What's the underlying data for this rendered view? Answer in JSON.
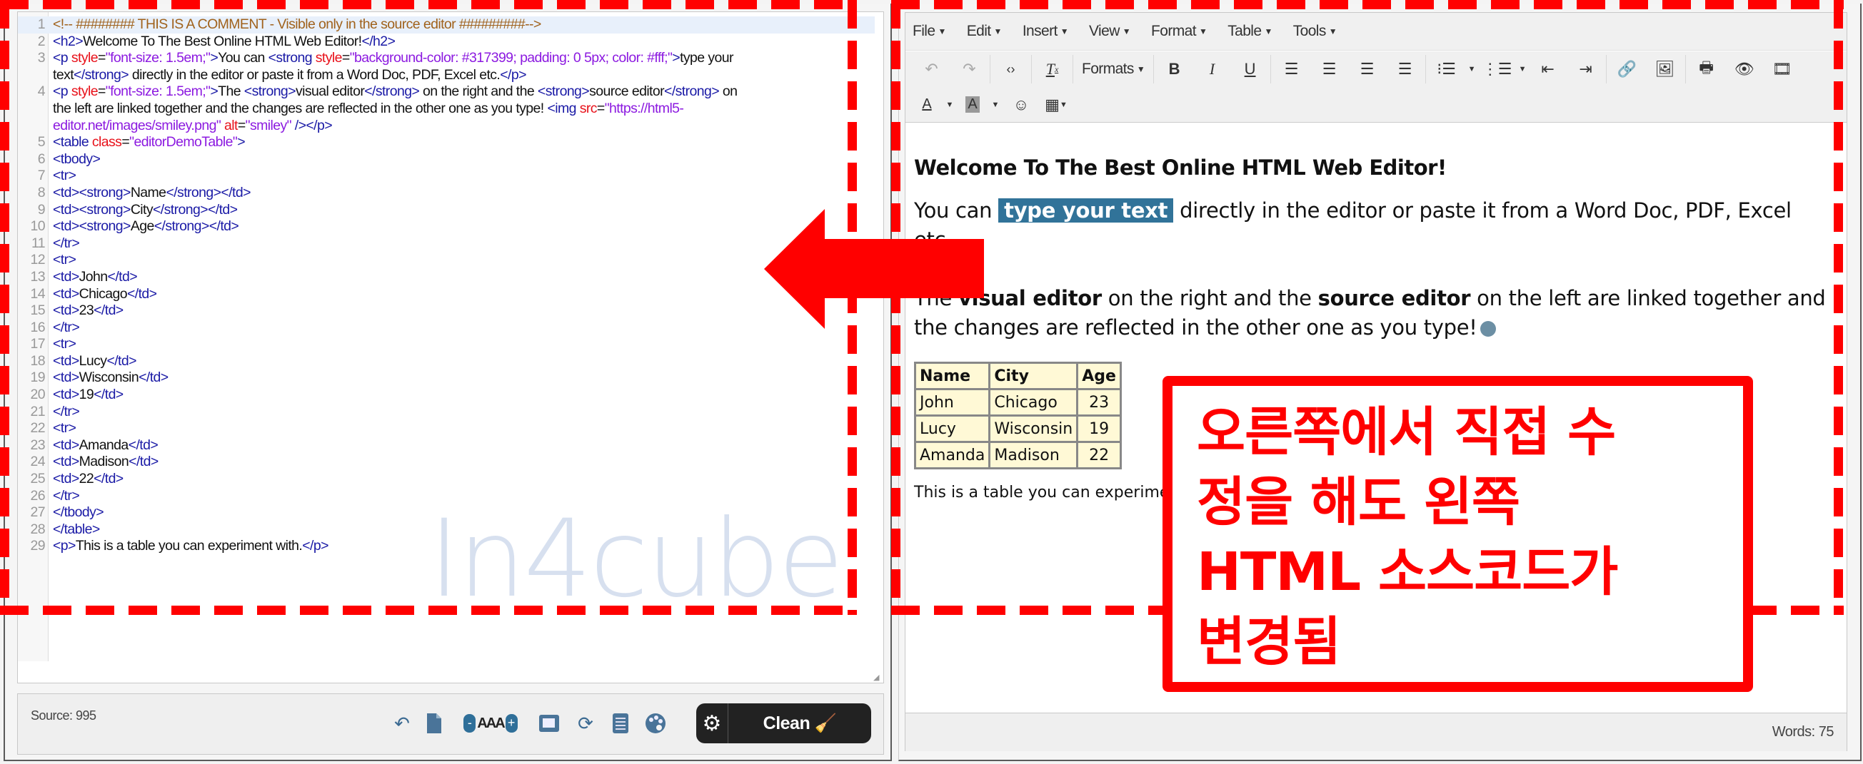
{
  "source_editor": {
    "lines": [
      {
        "n": "1",
        "html": "<span class='cm'>&lt;!-- ########  THIS IS A COMMENT - Visible only in the source editor #########--&gt;</span>"
      },
      {
        "n": "2",
        "html": "<span class='tg'>&lt;h2&gt;</span>Welcome To The Best Online HTML Web Editor!<span class='tg'>&lt;/h2&gt;</span>"
      },
      {
        "n": "3",
        "html": "<span class='tg'>&lt;p</span> <span class='at'>style</span>=<span class='av'>\"font-size: 1.5em;\"</span><span class='tg'>&gt;</span>You can <span class='tg'>&lt;strong</span> <span class='at'>style</span>=<span class='av'>\"background-color: #317399; padding: 0 5px; color: #fff;\"</span><span class='tg'>&gt;</span>type your",
        "cont": "text<span class='tg'>&lt;/strong&gt;</span> directly in the editor or paste it from a Word Doc, PDF, Excel etc.<span class='tg'>&lt;/p&gt;</span>"
      },
      {
        "n": "4",
        "html": "<span class='tg'>&lt;p</span> <span class='at'>style</span>=<span class='av'>\"font-size: 1.5em;\"</span><span class='tg'>&gt;</span>The <span class='tg'>&lt;strong&gt;</span>visual editor<span class='tg'>&lt;/strong&gt;</span> on the right and the <span class='tg'>&lt;strong&gt;</span>source editor<span class='tg'>&lt;/strong&gt;</span> on",
        "cont": "the left are linked together and the changes are reflected in the other one as you type! <span class='tg'>&lt;img</span> <span class='at'>src</span>=<span class='av'>\"https://html5-</span>",
        "cont2": "<span class='av'>editor.net/images/smiley.png\"</span> <span class='at'>alt</span>=<span class='av'>\"smiley\"</span> <span class='tg'>/&gt;&lt;/p&gt;</span>"
      },
      {
        "n": "5",
        "html": "<span class='tg'>&lt;table</span> <span class='at'>class</span>=<span class='av'>\"editorDemoTable\"</span><span class='tg'>&gt;</span>"
      },
      {
        "n": "6",
        "html": "<span class='tg'>&lt;tbody&gt;</span>"
      },
      {
        "n": "7",
        "html": "<span class='tg'>&lt;tr&gt;</span>"
      },
      {
        "n": "8",
        "html": "<span class='tg'>&lt;td&gt;&lt;strong&gt;</span>Name<span class='tg'>&lt;/strong&gt;&lt;/td&gt;</span>"
      },
      {
        "n": "9",
        "html": "<span class='tg'>&lt;td&gt;&lt;strong&gt;</span>City<span class='tg'>&lt;/strong&gt;&lt;/td&gt;</span>"
      },
      {
        "n": "10",
        "html": "<span class='tg'>&lt;td&gt;&lt;strong&gt;</span>Age<span class='tg'>&lt;/strong&gt;&lt;/td&gt;</span>"
      },
      {
        "n": "11",
        "html": "<span class='tg'>&lt;/tr&gt;</span>"
      },
      {
        "n": "12",
        "html": "<span class='tg'>&lt;tr&gt;</span>"
      },
      {
        "n": "13",
        "html": "<span class='tg'>&lt;td&gt;</span>John<span class='tg'>&lt;/td&gt;</span>"
      },
      {
        "n": "14",
        "html": "<span class='tg'>&lt;td&gt;</span>Chicago<span class='tg'>&lt;/td&gt;</span>"
      },
      {
        "n": "15",
        "html": "<span class='tg'>&lt;td&gt;</span>23<span class='tg'>&lt;/td&gt;</span>"
      },
      {
        "n": "16",
        "html": "<span class='tg'>&lt;/tr&gt;</span>"
      },
      {
        "n": "17",
        "html": "<span class='tg'>&lt;tr&gt;</span>"
      },
      {
        "n": "18",
        "html": "<span class='tg'>&lt;td&gt;</span>Lucy<span class='tg'>&lt;/td&gt;</span>"
      },
      {
        "n": "19",
        "html": "<span class='tg'>&lt;td&gt;</span>Wisconsin<span class='tg'>&lt;/td&gt;</span>"
      },
      {
        "n": "20",
        "html": "<span class='tg'>&lt;td&gt;</span>19<span class='tg'>&lt;/td&gt;</span>"
      },
      {
        "n": "21",
        "html": "<span class='tg'>&lt;/tr&gt;</span>"
      },
      {
        "n": "22",
        "html": "<span class='tg'>&lt;tr&gt;</span>"
      },
      {
        "n": "23",
        "html": "<span class='tg'>&lt;td&gt;</span>Amanda<span class='tg'>&lt;/td&gt;</span>"
      },
      {
        "n": "24",
        "html": "<span class='tg'>&lt;td&gt;</span>Madison<span class='tg'>&lt;/td&gt;</span>"
      },
      {
        "n": "25",
        "html": "<span class='tg'>&lt;td&gt;</span>22<span class='tg'>&lt;/td&gt;</span>"
      },
      {
        "n": "26",
        "html": "<span class='tg'>&lt;/tr&gt;</span>"
      },
      {
        "n": "27",
        "html": "<span class='tg'>&lt;/tbody&gt;</span>"
      },
      {
        "n": "28",
        "html": "<span class='tg'>&lt;/table&gt;</span>"
      },
      {
        "n": "29",
        "html": "<span class='tg'>&lt;p&gt;</span>This is a table you can experiment with.<span class='tg'>&lt;/p&gt;</span>"
      }
    ],
    "watermark": "In4cube",
    "footer": {
      "source_count": "Source: 995",
      "font_size_label": "AAA",
      "clean_label": "Clean"
    }
  },
  "visual_editor": {
    "menu": [
      "File",
      "Edit",
      "Insert",
      "View",
      "Format",
      "Table",
      "Tools"
    ],
    "formats_label": "Formats",
    "heading": "Welcome To The Best Online HTML Web Editor!",
    "para1": {
      "before": "You can ",
      "highlight": "type your text",
      "after": " directly in the editor or paste it from a Word Doc, PDF, Excel etc."
    },
    "para2": {
      "t1": "The ",
      "b1": "visual editor",
      "t2": " on the right and the ",
      "b2": "source editor",
      "t3": " on the left are linked together and the changes are reflected in the other one as you type!"
    },
    "table": {
      "headers": [
        "Name",
        "City",
        "Age"
      ],
      "rows": [
        [
          "John",
          "Chicago",
          "23"
        ],
        [
          "Lucy",
          "Wisconsin",
          "19"
        ],
        [
          "Amanda",
          "Madison",
          "22"
        ]
      ]
    },
    "para3": "This is a table you can experiment with.",
    "word_count": "Words: 75",
    "highlight_color": "#317399"
  },
  "annotation": {
    "callout_lines": [
      "오른쪽에서 직접 수",
      "정을 해도 왼쪽",
      "HTML 소스코드가",
      "변경됨"
    ],
    "color": "#ff0000"
  }
}
